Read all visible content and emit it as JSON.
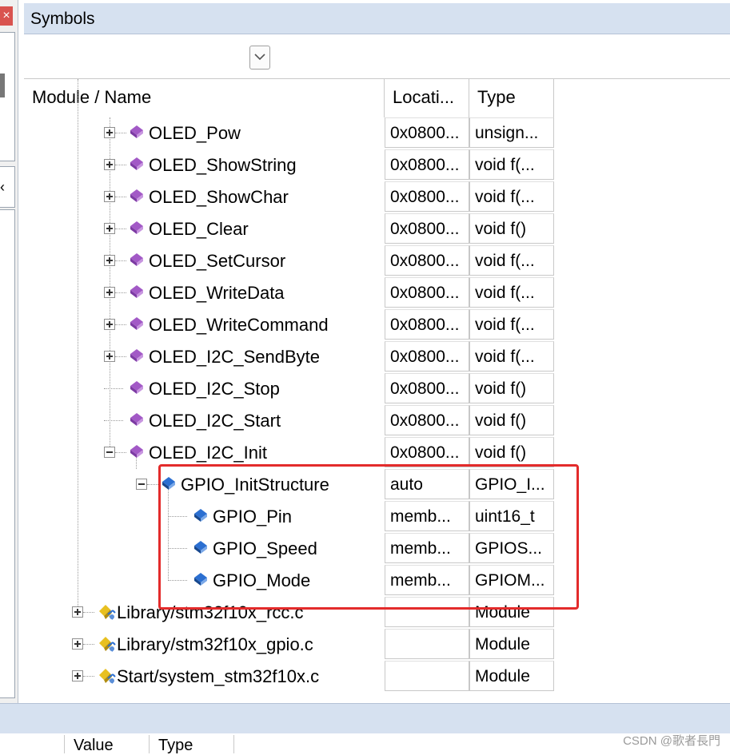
{
  "window": {
    "title": "Symbols"
  },
  "left_pane": {
    "close_glyph": "×",
    "collapse_glyph": "‹"
  },
  "filter": {
    "dropdown_icon": "chevron-down-icon"
  },
  "columns": {
    "name": "Module / Name",
    "location": "Locati...",
    "type": "Type"
  },
  "rows": [
    {
      "name": "OLED_Pow",
      "location": "0x0800...",
      "type": "unsign...",
      "icon": "function-icon",
      "expander": "plus"
    },
    {
      "name": "OLED_ShowString",
      "location": "0x0800...",
      "type": "void f(...",
      "icon": "function-icon",
      "expander": "plus"
    },
    {
      "name": "OLED_ShowChar",
      "location": "0x0800...",
      "type": "void f(...",
      "icon": "function-icon",
      "expander": "plus"
    },
    {
      "name": "OLED_Clear",
      "location": "0x0800...",
      "type": "void f()",
      "icon": "function-icon",
      "expander": "plus"
    },
    {
      "name": "OLED_SetCursor",
      "location": "0x0800...",
      "type": "void f(...",
      "icon": "function-icon",
      "expander": "plus"
    },
    {
      "name": "OLED_WriteData",
      "location": "0x0800...",
      "type": "void f(...",
      "icon": "function-icon",
      "expander": "plus"
    },
    {
      "name": "OLED_WriteCommand",
      "location": "0x0800...",
      "type": "void f(...",
      "icon": "function-icon",
      "expander": "plus"
    },
    {
      "name": "OLED_I2C_SendByte",
      "location": "0x0800...",
      "type": "void f(...",
      "icon": "function-icon",
      "expander": "plus"
    },
    {
      "name": "OLED_I2C_Stop",
      "location": "0x0800...",
      "type": "void f()",
      "icon": "function-icon",
      "expander": "none"
    },
    {
      "name": "OLED_I2C_Start",
      "location": "0x0800...",
      "type": "void f()",
      "icon": "function-icon",
      "expander": "none"
    },
    {
      "name": "OLED_I2C_Init",
      "location": "0x0800...",
      "type": "void f()",
      "icon": "function-icon",
      "expander": "minus"
    },
    {
      "name": "GPIO_InitStructure",
      "location": "auto",
      "type": "GPIO_I...",
      "icon": "variable-icon",
      "expander": "minus"
    },
    {
      "name": "GPIO_Pin",
      "location": "memb...",
      "type": "uint16_t",
      "icon": "member-icon",
      "expander": "none"
    },
    {
      "name": "GPIO_Speed",
      "location": "memb...",
      "type": "GPIOS...",
      "icon": "member-icon",
      "expander": "none"
    },
    {
      "name": "GPIO_Mode",
      "location": "memb...",
      "type": "GPIOM...",
      "icon": "member-icon",
      "expander": "none"
    },
    {
      "name": "Library/stm32f10x_rcc.c",
      "location": "",
      "type": "Module",
      "icon": "module-icon",
      "expander": "plus"
    },
    {
      "name": "Library/stm32f10x_gpio.c",
      "location": "",
      "type": "Module",
      "icon": "module-icon",
      "expander": "plus"
    },
    {
      "name": "Start/system_stm32f10x.c",
      "location": "",
      "type": "Module",
      "icon": "module-icon",
      "expander": "plus"
    }
  ],
  "bottom_panel": {
    "col_value": "Value",
    "col_type": "Type"
  },
  "watermark": "CSDN @歌者長門",
  "colors": {
    "titlebar": "#d6e1f0",
    "function": "#a259c6",
    "variable": "#2b6fd1",
    "highlight": "#e32b2b"
  }
}
